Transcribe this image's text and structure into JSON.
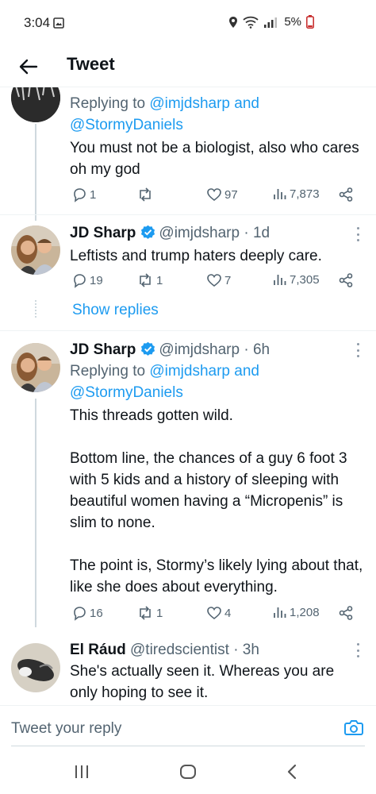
{
  "status_bar": {
    "time": "3:04",
    "battery": "5%"
  },
  "header": {
    "title": "Tweet"
  },
  "tweets": [
    {
      "reply_prefix": "Replying to",
      "reply_to_1": "@imjdsharp",
      "reply_and": "and",
      "reply_to_2": "@StormyDaniels",
      "text": "You must not be a biologist, also who cares oh my god",
      "replies": "1",
      "retweets": "",
      "likes": "97",
      "views": "7,873"
    },
    {
      "name": "JD Sharp",
      "handle": "@imjdsharp",
      "time": "· 1d",
      "text": "Leftists and trump haters deeply care.",
      "replies": "19",
      "retweets": "1",
      "likes": "7",
      "views": "7,305",
      "show_replies": "Show replies"
    },
    {
      "name": "JD Sharp",
      "handle": "@imjdsharp",
      "time": "· 6h",
      "reply_prefix": "Replying to",
      "reply_to_1": "@imjdsharp",
      "reply_and": "and",
      "reply_to_2": "@StormyDaniels",
      "text": "This threads gotten wild.\n\nBottom line, the chances of a guy 6 foot 3 with 5 kids and a history of sleeping with beautiful women having a “Micropenis” is slim to none.\n\nThe point is, Stormy’s likely lying about that, like she does about everything.",
      "replies": "16",
      "retweets": "1",
      "likes": "4",
      "views": "1,208"
    },
    {
      "name": "El Ráud",
      "handle": "@tiredscientist",
      "time": "· 3h",
      "text": "She's actually seen it. Whereas you are only hoping to see it."
    }
  ],
  "composer": {
    "placeholder": "Tweet your reply"
  },
  "icons": {
    "reply": "reply-icon",
    "retweet": "retweet-icon",
    "like": "heart-icon",
    "views": "views-icon",
    "share": "share-icon",
    "verified": "verified-icon",
    "camera": "camera-icon",
    "back": "back-arrow-icon"
  },
  "colors": {
    "accent": "#1d9bf0",
    "text": "#0f1419",
    "muted": "#536471",
    "divider": "#eff3f4"
  }
}
